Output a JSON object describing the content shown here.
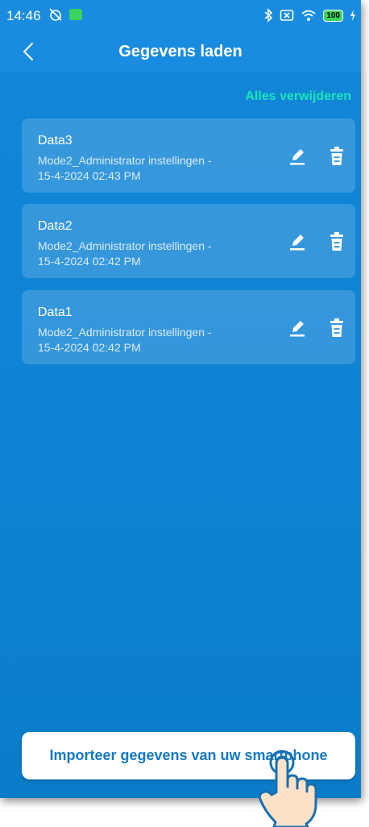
{
  "status": {
    "time": "14:46",
    "battery": "100"
  },
  "header": {
    "title": "Gegevens laden"
  },
  "actions": {
    "delete_all": "Alles verwijderen"
  },
  "items": [
    {
      "title": "Data3",
      "line1": "Mode2_Administrator instellingen -",
      "line2": "15-4-2024 02:43 PM"
    },
    {
      "title": "Data2",
      "line1": "Mode2_Administrator instellingen -",
      "line2": "15-4-2024 02:42 PM"
    },
    {
      "title": "Data1",
      "line1": "Mode2_Administrator instellingen -",
      "line2": "15-4-2024 02:42 PM"
    }
  ],
  "footer": {
    "import_label": "Importeer gegevens van uw smartphone"
  },
  "colors": {
    "background": "#1287d8",
    "accent": "#18e6b9",
    "button_text": "#1478c4"
  }
}
